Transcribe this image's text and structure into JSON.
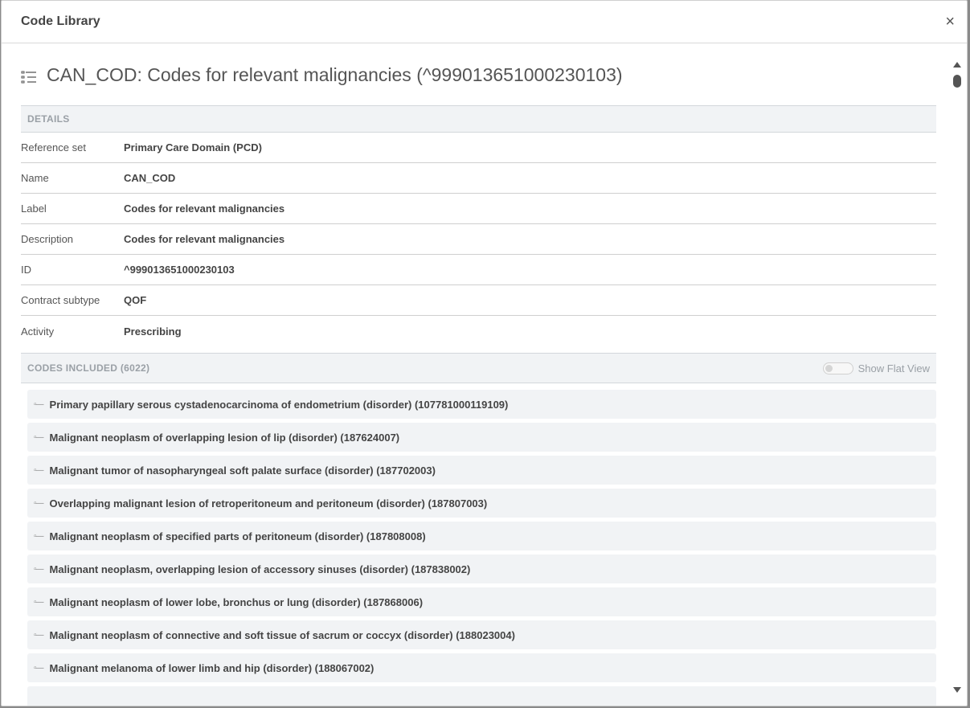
{
  "modal": {
    "title": "Code Library",
    "close_label": "×"
  },
  "codelist": {
    "title": "CAN_COD: Codes for relevant malignancies (^999013651000230103)"
  },
  "details": {
    "header": "DETAILS",
    "rows": [
      {
        "label": "Reference set",
        "value": "Primary Care Domain (PCD)"
      },
      {
        "label": "Name",
        "value": "CAN_COD"
      },
      {
        "label": "Label",
        "value": "Codes for relevant malignancies"
      },
      {
        "label": "Description",
        "value": "Codes for relevant malignancies"
      },
      {
        "label": "ID",
        "value": "^999013651000230103"
      },
      {
        "label": "Contract subtype",
        "value": "QOF"
      },
      {
        "label": "Activity",
        "value": "Prescribing"
      }
    ]
  },
  "codes": {
    "header": "CODES INCLUDED (6022)",
    "toggle_label": "Show Flat View",
    "toggle_on": false,
    "items": [
      "Primary papillary serous cystadenocarcinoma of endometrium (disorder) (107781000119109)",
      "Malignant neoplasm of overlapping lesion of lip (disorder) (187624007)",
      "Malignant tumor of nasopharyngeal soft palate surface (disorder) (187702003)",
      "Overlapping malignant lesion of retroperitoneum and peritoneum (disorder) (187807003)",
      "Malignant neoplasm of specified parts of peritoneum (disorder) (187808008)",
      "Malignant neoplasm, overlapping lesion of accessory sinuses (disorder) (187838002)",
      "Malignant neoplasm of lower lobe, bronchus or lung (disorder) (187868006)",
      "Malignant neoplasm of connective and soft tissue of sacrum or coccyx (disorder) (188023004)",
      "Malignant melanoma of lower limb and hip (disorder) (188067002)",
      ""
    ]
  }
}
